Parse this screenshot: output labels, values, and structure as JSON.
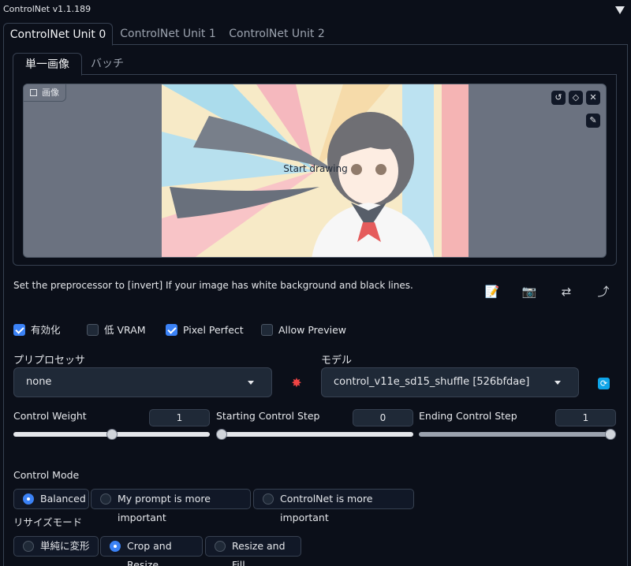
{
  "app": {
    "title": "ControlNet v1.1.189"
  },
  "unit_tabs": [
    "ControlNet Unit 0",
    "ControlNet Unit 1",
    "ControlNet Unit 2"
  ],
  "image_tabs": [
    "単一画像",
    "バッチ"
  ],
  "canvas": {
    "label": "画像",
    "hint": "Start drawing"
  },
  "info_text": "Set the preprocessor to [invert] If your image has white background and black lines.",
  "checkboxes": [
    {
      "label": "有効化",
      "checked": true
    },
    {
      "label": "低 VRAM",
      "checked": false
    },
    {
      "label": "Pixel Perfect",
      "checked": true
    },
    {
      "label": "Allow Preview",
      "checked": false
    }
  ],
  "preprocessor": {
    "label": "プリプロセッサ",
    "value": "none"
  },
  "model": {
    "label": "モデル",
    "value": "control_v11e_sd15_shuffle [526bfdae]"
  },
  "sliders": [
    {
      "label": "Control Weight",
      "value": "1",
      "fraction": 0.5
    },
    {
      "label": "Starting Control Step",
      "value": "0",
      "fraction": 0
    },
    {
      "label": "Ending Control Step",
      "value": "1",
      "fraction": 1
    }
  ],
  "control_mode": {
    "label": "Control Mode",
    "options": [
      "Balanced",
      "My prompt is more important",
      "ControlNet is more important"
    ],
    "selected": 0
  },
  "resize_mode": {
    "label": "リサイズモード",
    "options": [
      "単純に変形",
      "Crop and Resize",
      "Resize and Fill"
    ],
    "selected": 1
  },
  "colors": {
    "accent": "#3b82f6",
    "background": "#0b0f19",
    "surface": "#1f2937"
  },
  "icons": [
    "undo-icon",
    "eraser-icon",
    "close-icon",
    "brush-icon",
    "new-canvas-icon",
    "camera-icon",
    "swap-dimensions-icon",
    "send-dimensions-icon",
    "explosion-icon",
    "refresh-icon"
  ]
}
